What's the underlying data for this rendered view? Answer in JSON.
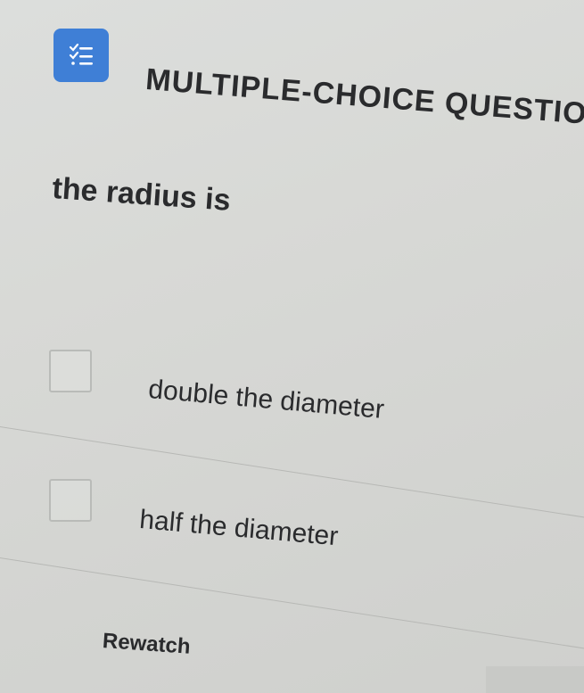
{
  "question": {
    "type_label": "MULTIPLE-CHOICE QUESTION",
    "icon": "checklist-icon",
    "text": "the radius is"
  },
  "options": [
    {
      "label": "double the diameter",
      "checked": false
    },
    {
      "label": "half the diameter",
      "checked": false
    }
  ],
  "actions": {
    "rewatch_label": "Rewatch"
  },
  "colors": {
    "badge": "#3f7fd6",
    "text": "#2a2b2d",
    "background": "#d8d9d6"
  }
}
